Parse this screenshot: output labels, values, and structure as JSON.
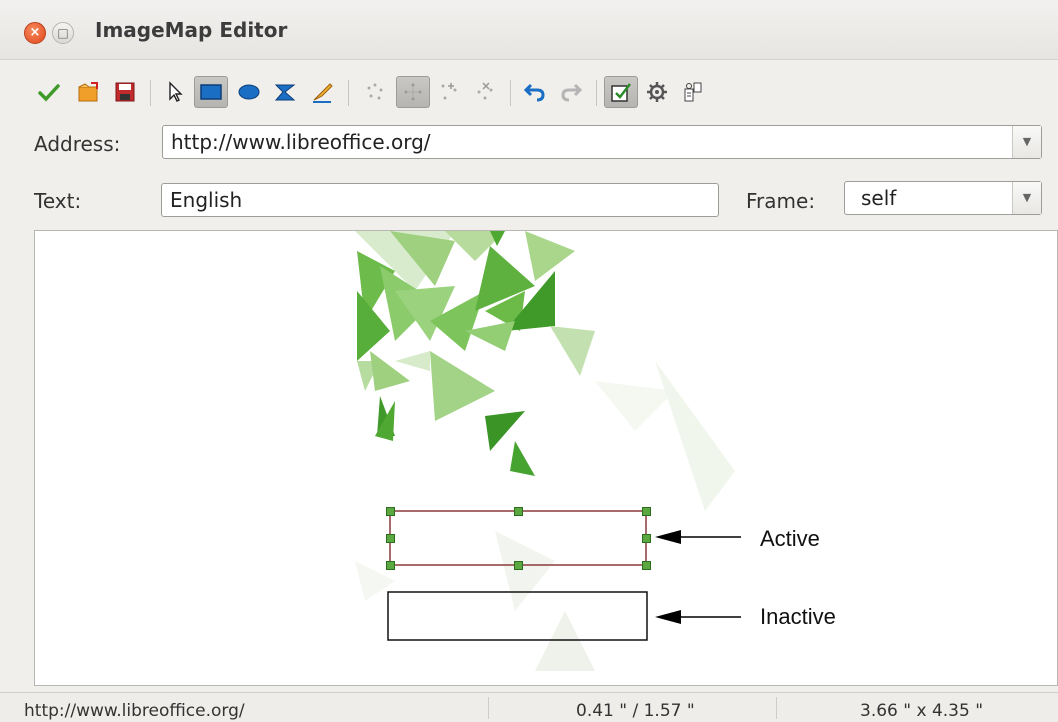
{
  "window": {
    "title": "ImageMap Editor"
  },
  "toolbar": {
    "items": [
      {
        "name": "apply-icon"
      },
      {
        "name": "open-icon"
      },
      {
        "name": "save-icon"
      },
      {
        "name": "select-icon"
      },
      {
        "name": "rectangle-icon"
      },
      {
        "name": "ellipse-icon"
      },
      {
        "name": "polygon-icon"
      },
      {
        "name": "freeform-polygon-icon"
      },
      {
        "name": "edit-points-icon"
      },
      {
        "name": "move-points-icon"
      },
      {
        "name": "insert-points-icon"
      },
      {
        "name": "delete-points-icon"
      },
      {
        "name": "undo-icon"
      },
      {
        "name": "redo-icon"
      },
      {
        "name": "active-icon"
      },
      {
        "name": "macro-icon"
      },
      {
        "name": "properties-icon"
      }
    ]
  },
  "form": {
    "address_label": "Address:",
    "address_value": "http://www.libreoffice.org/",
    "text_label": "Text:",
    "text_value": "English",
    "frame_label": "Frame:",
    "frame_value": "self"
  },
  "canvas": {
    "annotations": {
      "active": "Active",
      "inactive": "Inactive"
    }
  },
  "status": {
    "url": "http://www.libreoffice.org/",
    "position": "0.41 \" / 1.57 \"",
    "size": "3.66 \" x 4.35 \""
  },
  "colors": {
    "accent_green": "#3f9a2a",
    "selection_border": "#8b3a3a",
    "close_button": "#e0471c"
  }
}
